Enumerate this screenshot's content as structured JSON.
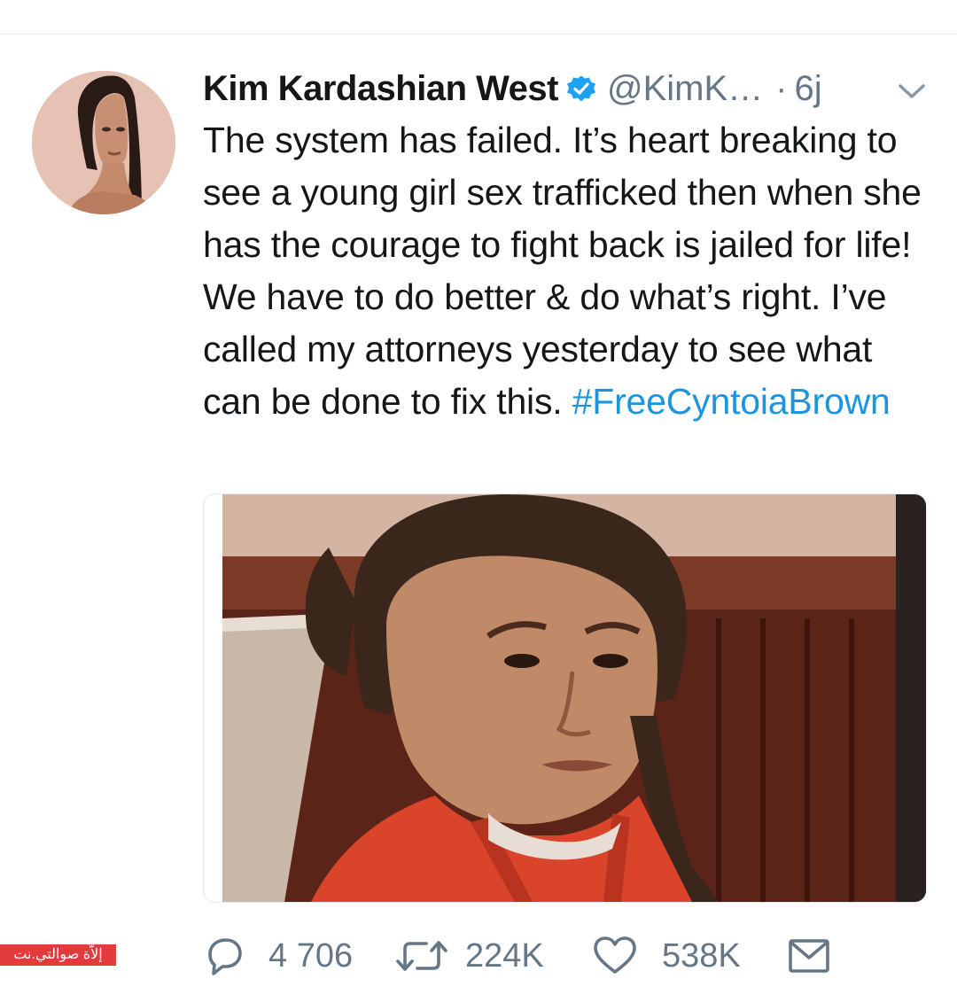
{
  "tweet": {
    "author_name": "Kim Kardashian West",
    "handle": "@KimK…",
    "separator": "·",
    "timestamp": "6j",
    "text_main": "The system has failed. It’s heart breaking to see a young girl sex trafficked then when she has the courage to fight back is jailed for life! We have to do better & do what’s right. I’ve called my attorneys yesterday to see what can be done to fix this. ",
    "hashtag": "#FreeCyntoiaBrown"
  },
  "actions": {
    "reply_count": "4 706",
    "retweet_count": "224K",
    "like_count": "538K"
  },
  "watermark": {
    "text": "إلاّة صوالتي.نت"
  },
  "icons": {
    "verified": "verified-badge-icon",
    "chevron": "chevron-down-icon",
    "reply": "reply-icon",
    "retweet": "retweet-icon",
    "like": "heart-icon",
    "dm": "envelope-icon"
  },
  "colors": {
    "link": "#1b95e0",
    "secondary_text": "#657786",
    "verified": "#1da1f2",
    "divider": "#e1e8ed"
  }
}
